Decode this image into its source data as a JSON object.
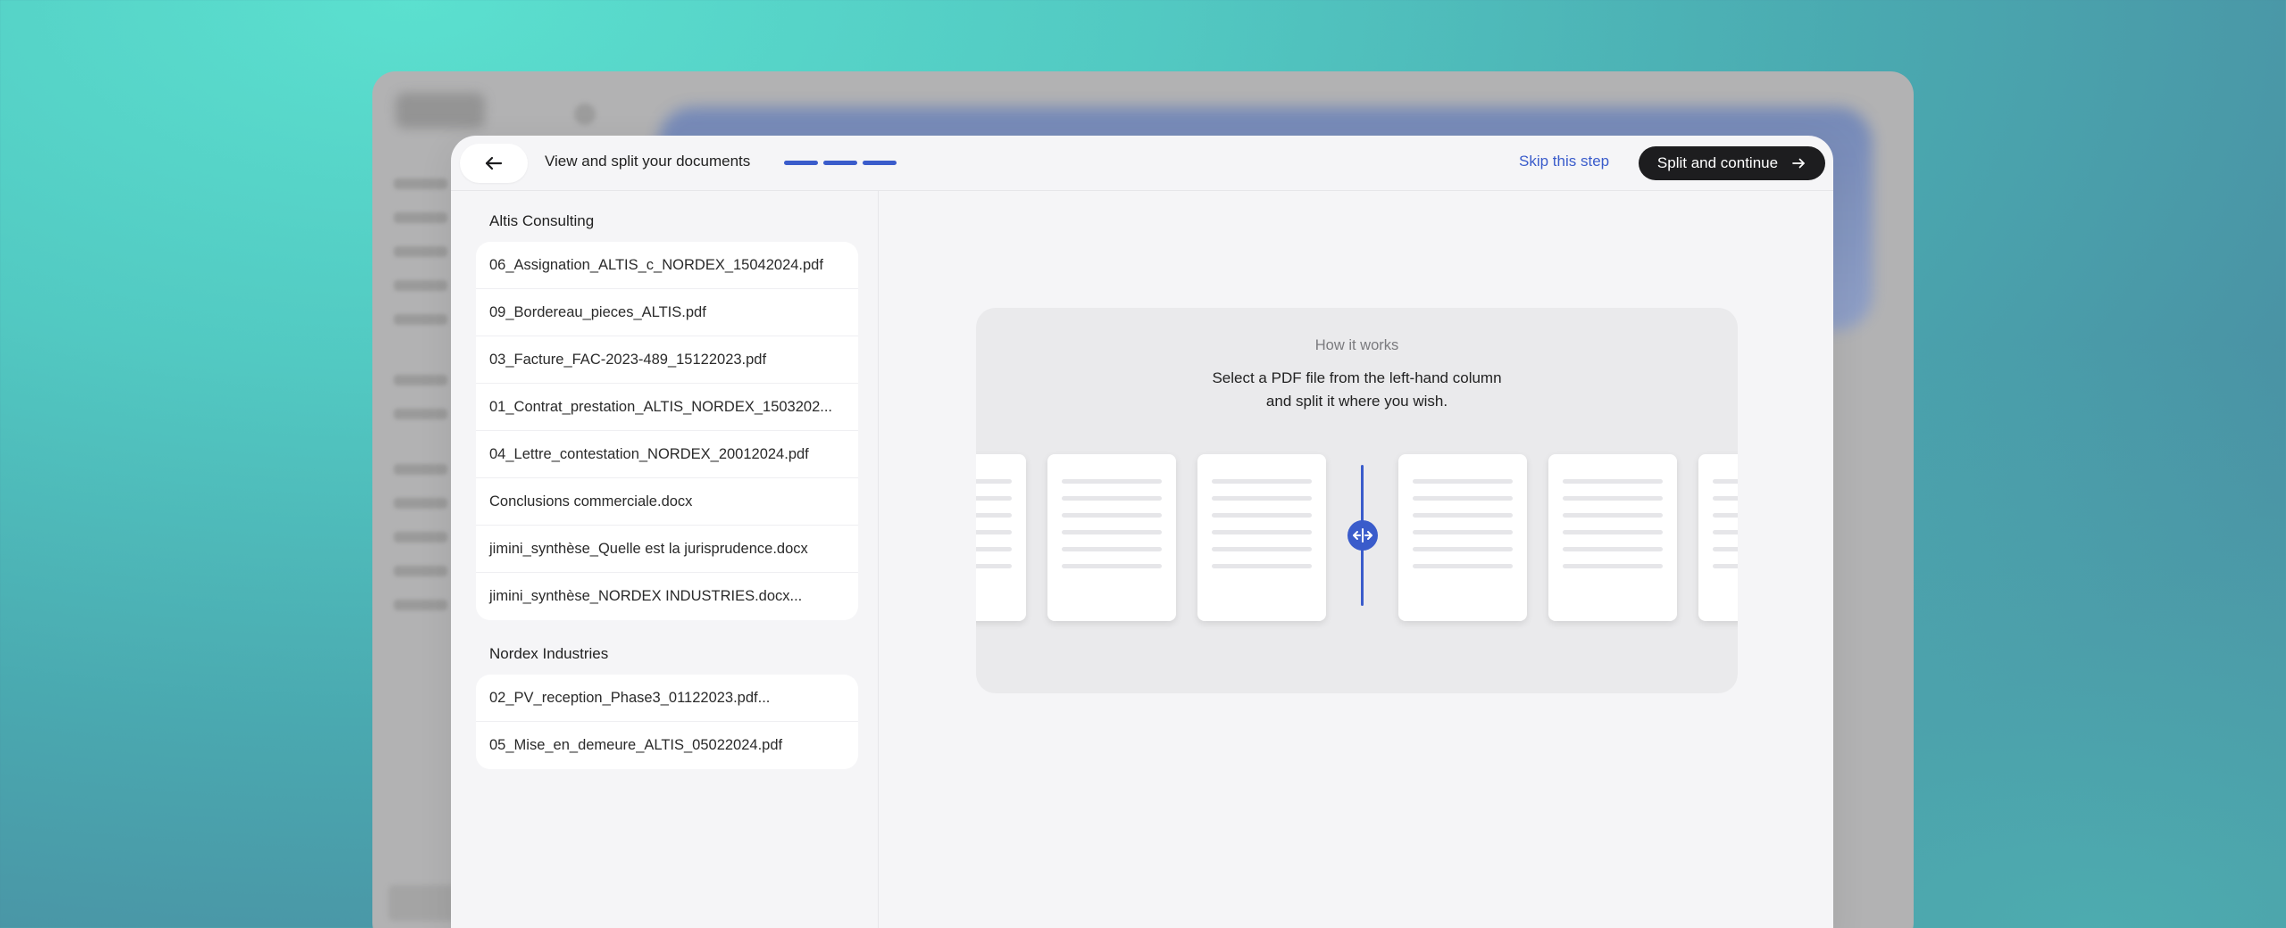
{
  "header": {
    "title": "View and split your documents",
    "progress_steps": 3,
    "skip_label": "Skip this step",
    "continue_label": "Split and continue"
  },
  "groups": [
    {
      "title": "Altis Consulting",
      "files": [
        "06_Assignation_ALTIS_c_NORDEX_15042024.pdf",
        "09_Bordereau_pieces_ALTIS.pdf",
        "03_Facture_FAC-2023-489_15122023.pdf",
        "01_Contrat_prestation_ALTIS_NORDEX_1503202...",
        "04_Lettre_contestation_NORDEX_20012024.pdf",
        "Conclusions commerciale.docx",
        "jimini_synthèse_Quelle est la jurisprudence.docx",
        "jimini_synthèse_NORDEX INDUSTRIES.docx..."
      ]
    },
    {
      "title": "Nordex Industries",
      "files": [
        "02_PV_reception_Phase3_01122023.pdf...",
        "05_Mise_en_demeure_ALTIS_05022024.pdf"
      ]
    }
  ],
  "how_it_works": {
    "heading": "How it works",
    "line1": "Select a PDF file from the left-hand column",
    "line2": "and split it where you wish."
  },
  "colors": {
    "accent": "#3a5ccb",
    "primary_button": "#1d1d1f",
    "panel_bg": "#f5f5f7"
  },
  "icons": {
    "back": "arrow-left-icon",
    "continue": "arrow-right-icon",
    "split": "split-handle-icon"
  }
}
